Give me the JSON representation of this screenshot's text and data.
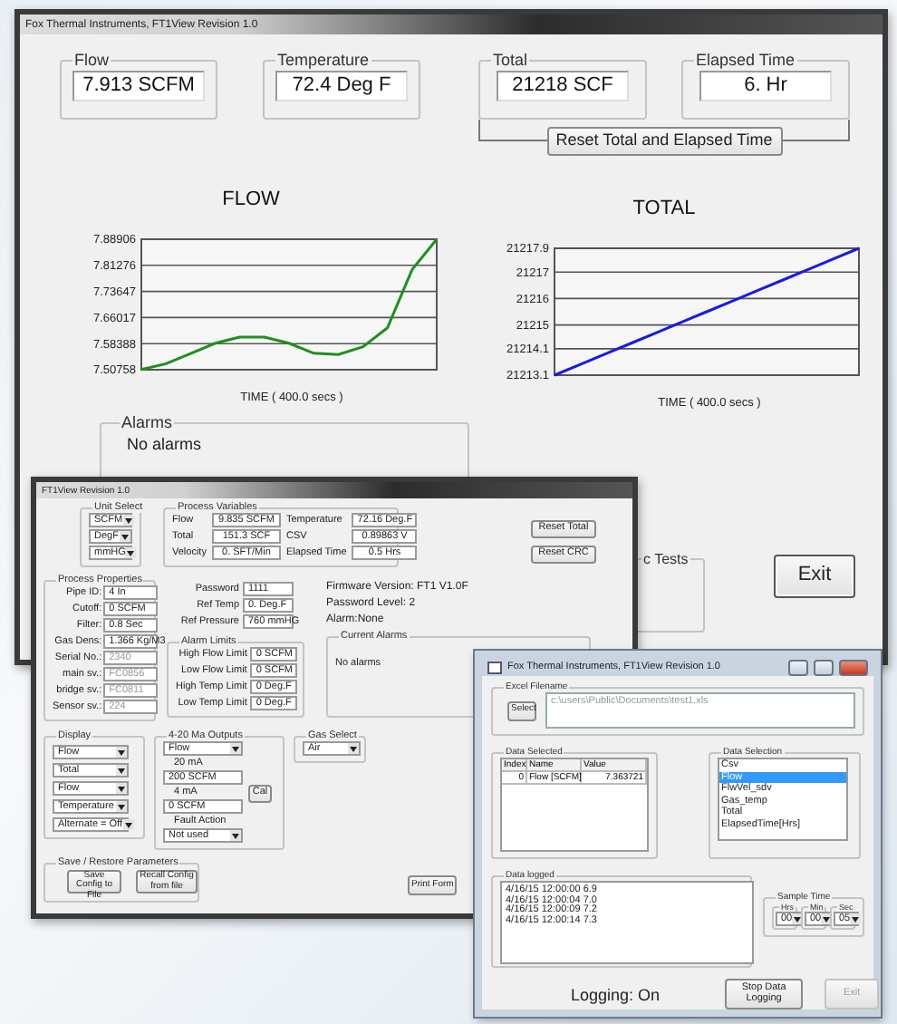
{
  "main_window": {
    "title": "Fox Thermal Instruments,  FT1View Revision 1.0",
    "readouts": [
      {
        "label": "Flow",
        "value": "7.913 SCFM"
      },
      {
        "label": "Temperature",
        "value": "72.4 Deg F"
      },
      {
        "label": "Total",
        "value": "21218 SCF"
      },
      {
        "label": "Elapsed Time",
        "value": "6.  Hr"
      }
    ],
    "reset_button": "Reset Total and Elapsed Time",
    "charts": [
      {
        "chart_data": {
          "type": "line",
          "title": "FLOW",
          "xlabel": "TIME ( 400.0 secs )",
          "ylim": [
            7.50758,
            7.88906
          ],
          "yticks": [
            7.50758,
            7.58388,
            7.66017,
            7.73647,
            7.81276,
            7.88906
          ],
          "grid": true,
          "series": [
            {
              "color": "#1f8f1f",
              "values": [
                7.508,
                7.525,
                7.555,
                7.585,
                7.603,
                7.603,
                7.585,
                7.556,
                7.552,
                7.575,
                7.63,
                7.8,
                7.889
              ]
            }
          ]
        }
      },
      {
        "chart_data": {
          "type": "line",
          "title": "TOTAL",
          "xlabel": "TIME ( 400.0 secs )",
          "ylim": [
            21213.1,
            21217.9
          ],
          "yticks": [
            21213.1,
            21214.1,
            21215,
            21216,
            21217,
            21217.9
          ],
          "grid": true,
          "series": [
            {
              "color": "#1a1ae0",
              "values": [
                21213.1,
                21213.5,
                21213.9,
                21214.3,
                21214.7,
                21215.1,
                21215.5,
                21215.9,
                21216.3,
                21216.7,
                21217.1,
                21217.5,
                21217.9
              ]
            }
          ]
        }
      }
    ],
    "alarms": {
      "title": "Alarms",
      "message": "No alarms"
    },
    "tests_group": {
      "title": "c Tests"
    },
    "exit_button": "Exit"
  },
  "setup_window": {
    "title": "FT1View Revision 1.0",
    "unit_select": {
      "title": "Unit Select",
      "options": [
        "SCFM",
        "DegF",
        "mmHG"
      ]
    },
    "process_variables": {
      "title": "Process Variables",
      "rows": [
        {
          "label": "Flow",
          "value": "9.835 SCFM"
        },
        {
          "label": "Temperature",
          "value": "72.16 Deg.F"
        },
        {
          "label": "Total",
          "value": "151.3 SCF"
        },
        {
          "label": "CSV",
          "value": "0.89863 V"
        },
        {
          "label": "Velocity",
          "value": "0. SFT/Min"
        },
        {
          "label": "Elapsed Time",
          "value": "0.5 Hrs"
        }
      ]
    },
    "reset_buttons": [
      "Reset Total",
      "Reset CRC"
    ],
    "process_properties": {
      "title": "Process Properties",
      "rows": [
        {
          "label": "Pipe ID:",
          "value": "4 In",
          "disabled": false
        },
        {
          "label": "Cutoff:",
          "value": "0 SCFM",
          "disabled": false
        },
        {
          "label": "Filter:",
          "value": "0.8 Sec",
          "disabled": false
        },
        {
          "label": "Gas Dens:",
          "value": "1.366 Kg/M3",
          "disabled": false
        },
        {
          "label": "Serial No.:",
          "value": "2340",
          "disabled": true
        },
        {
          "label": "main sv.:",
          "value": "FC0856",
          "disabled": true
        },
        {
          "label": "bridge sv.:",
          "value": "FC0811",
          "disabled": true
        },
        {
          "label": "Sensor sv.:",
          "value": "224",
          "disabled": true
        }
      ]
    },
    "settings": [
      {
        "label": "Password",
        "value": "1111"
      },
      {
        "label": "Ref Temp",
        "value": "0. Deg.F"
      },
      {
        "label": "Ref Pressure",
        "value": "760  mmHG"
      }
    ],
    "status_lines": [
      "Firmware Version: FT1 V1.0F",
      "Password Level: 2",
      "Alarm:None"
    ],
    "alarm_limits": {
      "title": "Alarm Limits",
      "rows": [
        {
          "label": "High Flow Limit",
          "value": "0 SCFM"
        },
        {
          "label": "Low Flow Limit",
          "value": "0 SCFM"
        },
        {
          "label": "High Temp Limit",
          "value": "0 Deg.F"
        },
        {
          "label": "Low Temp Limit",
          "value": "0 Deg.F"
        }
      ]
    },
    "current_alarms": {
      "title": "Current Alarms",
      "message": "No alarms"
    },
    "display": {
      "title": "Display",
      "options": [
        "Flow",
        "Total",
        "Flow",
        "Temperature",
        "Alternate = Off"
      ]
    },
    "outputs": {
      "title": "4-20 Ma Outputs",
      "source": "Flow",
      "high_label": "20 mA",
      "high_value": "200 SCFM",
      "low_label": "4 mA",
      "low_value": "0 SCFM",
      "fault_label": "Fault Action",
      "fault_value": "Not used",
      "cal_button": "Cal"
    },
    "gas_select": {
      "title": "Gas Select",
      "value": "Air"
    },
    "save_restore": {
      "title": "Save / Restore Parameters",
      "buttons": [
        "Save Config to File",
        "Recall Config from file"
      ]
    },
    "print_button": "Print Form"
  },
  "logging_window": {
    "title": "Fox Thermal Instruments,  FT1View Revision 1.0",
    "excel": {
      "title": "Excel Filename",
      "select_button": "Select",
      "path": "c:\\users\\Public\\Documents\\test1.xls"
    },
    "data_selected": {
      "title": "Data Selected",
      "columns": [
        "Index",
        "Name",
        "Value"
      ],
      "rows": [
        [
          "0",
          "Flow [SCFM]",
          "7.363721"
        ]
      ]
    },
    "data_selection": {
      "title": "Data Selection",
      "items": [
        {
          "label": "Csv",
          "selected": false
        },
        {
          "label": "Flow",
          "selected": true
        },
        {
          "label": "FlwVel_sdv",
          "selected": false
        },
        {
          "label": "Gas_temp",
          "selected": false
        },
        {
          "label": "Total",
          "selected": false
        },
        {
          "label": "ElapsedTime[Hrs]",
          "selected": false
        }
      ]
    },
    "data_logged": {
      "title": "Data logged",
      "lines": [
        "4/16/15 12:00:00  6.9",
        "4/16/15 12:00:04  7.0",
        "4/16/15 12:00:09  7.2",
        "4/16/15 12:00:14  7.3"
      ]
    },
    "sample_time": {
      "title": "Sample Time",
      "fields": [
        {
          "label": "Hrs",
          "value": "00"
        },
        {
          "label": "Min",
          "value": "00"
        },
        {
          "label": "Sec",
          "value": "05"
        }
      ]
    },
    "status": "Logging: On",
    "stop_button": "Stop Data Logging",
    "exit_button": {
      "label": "Exit",
      "disabled": true
    }
  }
}
